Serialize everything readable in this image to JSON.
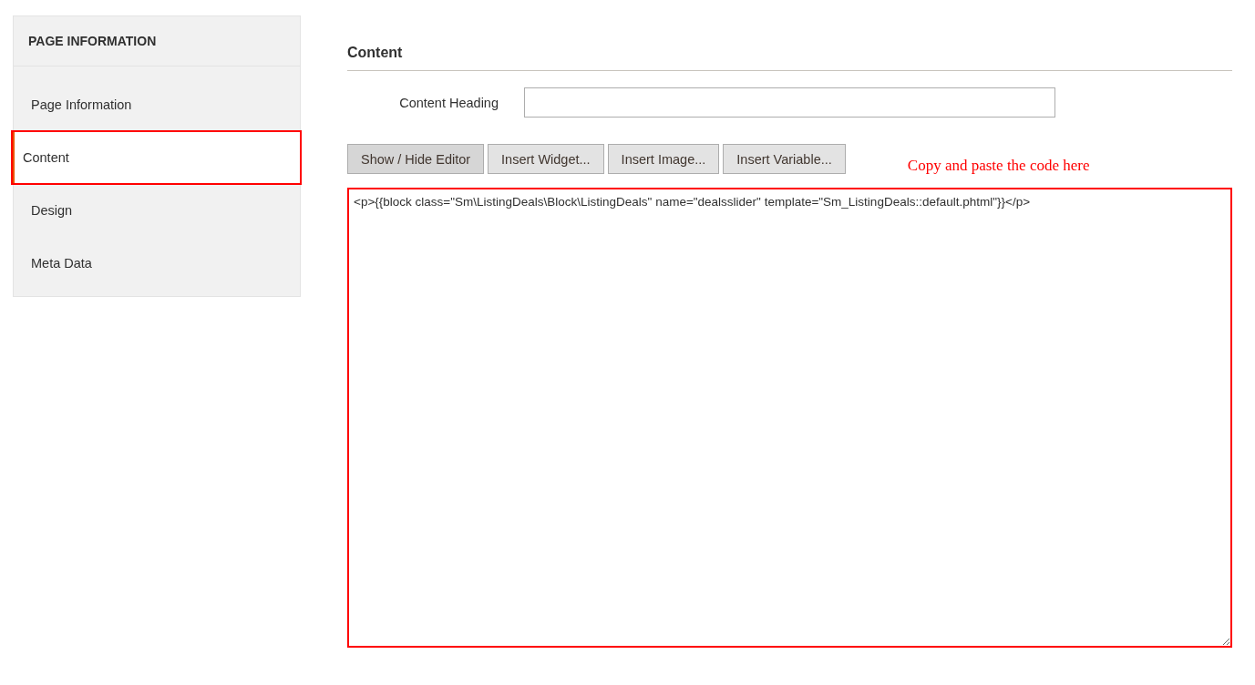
{
  "sidebar": {
    "title": "PAGE INFORMATION",
    "items": [
      {
        "label": "Page Information",
        "selected": false,
        "highlighted": false
      },
      {
        "label": "Content",
        "selected": true,
        "highlighted": true
      },
      {
        "label": "Design",
        "selected": false,
        "highlighted": false
      },
      {
        "label": "Meta Data",
        "selected": false,
        "highlighted": false
      }
    ]
  },
  "section": {
    "title": "Content",
    "heading_field": {
      "label": "Content Heading"
    },
    "buttons": [
      {
        "label": "Show / Hide Editor",
        "selected": true
      },
      {
        "label": "Insert Widget...",
        "selected": false
      },
      {
        "label": "Insert Image...",
        "selected": false
      },
      {
        "label": "Insert Variable...",
        "selected": false
      }
    ],
    "annotation": "Copy and paste the code here",
    "editor": {
      "value": "<p>{{block class=\"Sm\\ListingDeals\\Block\\ListingDeals\" name=\"dealsslider\" template=\"Sm_ListingDeals::default.phtml\"}}</p>",
      "highlighted": true
    }
  }
}
